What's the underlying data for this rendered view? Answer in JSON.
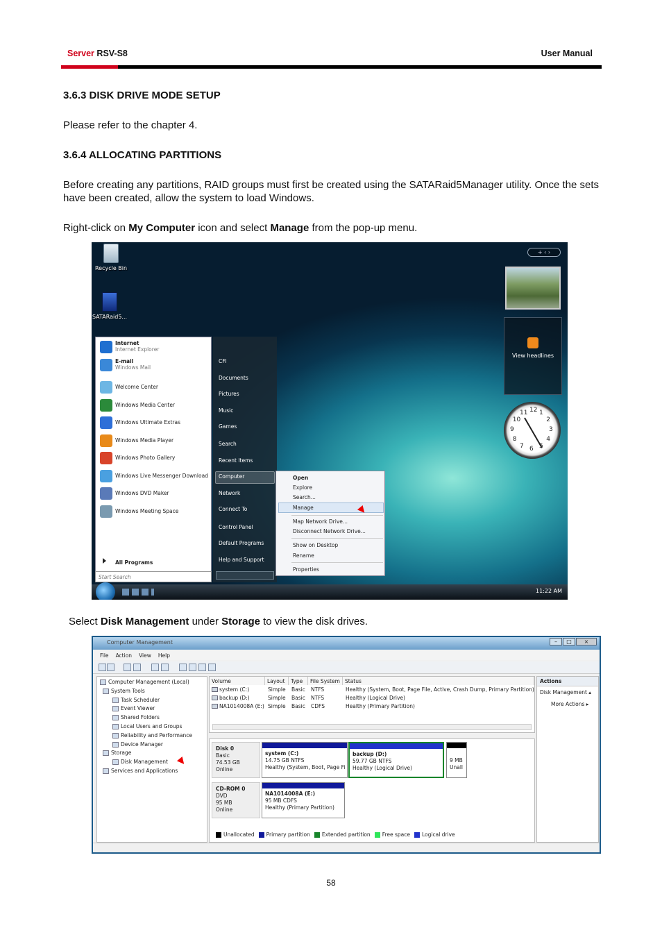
{
  "header": {
    "brand": "Server",
    "model": "RSV-S8",
    "right": "User Manual"
  },
  "sections": [
    {
      "title": "3.6.3 DISK DRIVE MODE SETUP",
      "text": "Please refer to the chapter 4."
    },
    {
      "title": "3.6.4 ALLOCATING PARTITIONS",
      "text": "Before creating any partitions, RAID groups must first be created using the SATARaid5Manager utility. Once the sets have been created, allow the system to load Windows."
    }
  ],
  "instruction1": {
    "pre": "Right-click on ",
    "b1": "My Computer",
    "mid": " icon and select ",
    "b2": "Manage",
    "post": " from the pop-up menu."
  },
  "instruction2": {
    "pre": "Select ",
    "b1": "Disk Management",
    "mid": " under ",
    "b2": "Storage",
    "post": " to view the disk drives."
  },
  "desktop": {
    "icons": [
      "Recycle Bin",
      "SATARaid5..."
    ],
    "gadget_feed": "View headlines",
    "clock_numbers": [
      "12",
      "1",
      "2",
      "3",
      "4",
      "5",
      "6",
      "7",
      "8",
      "9",
      "10",
      "11"
    ],
    "tray_time": "11:22 AM",
    "start_left": [
      {
        "name": "Internet",
        "sub": "Internet Explorer"
      },
      {
        "name": "E-mail",
        "sub": "Windows Mail"
      },
      {
        "name": "Welcome Center"
      },
      {
        "name": "Windows Media Center"
      },
      {
        "name": "Windows Ultimate Extras"
      },
      {
        "name": "Windows Media Player"
      },
      {
        "name": "Windows Photo Gallery"
      },
      {
        "name": "Windows Live Messenger Download"
      },
      {
        "name": "Windows DVD Maker"
      },
      {
        "name": "Windows Meeting Space"
      }
    ],
    "all_programs": "All Programs",
    "start_search": "Start Search",
    "start_right": [
      "CFI",
      "Documents",
      "Pictures",
      "Music",
      "Games",
      "Search",
      "Recent Items",
      "Computer",
      "Network",
      "Connect To",
      "Control Panel",
      "Default Programs",
      "Help and Support"
    ],
    "context_menu": [
      "Open",
      "Explore",
      "Search...",
      "Manage",
      "Map Network Drive...",
      "Disconnect Network Drive...",
      "Show on Desktop",
      "Rename",
      "Properties"
    ]
  },
  "cm": {
    "title": "Computer Management",
    "menu": [
      "File",
      "Action",
      "View",
      "Help"
    ],
    "tree": [
      "Computer Management (Local)",
      "System Tools",
      "Task Scheduler",
      "Event Viewer",
      "Shared Folders",
      "Local Users and Groups",
      "Reliability and Performance",
      "Device Manager",
      "Storage",
      "Disk Management",
      "Services and Applications"
    ],
    "columns": [
      "Volume",
      "Layout",
      "Type",
      "File System",
      "Status"
    ],
    "volumes": [
      [
        "system (C:)",
        "Simple",
        "Basic",
        "NTFS",
        "Healthy (System, Boot, Page File, Active, Crash Dump, Primary Partition)"
      ],
      [
        "backup (D:)",
        "Simple",
        "Basic",
        "NTFS",
        "Healthy (Logical Drive)"
      ],
      [
        "NA1014008A (E:)",
        "Simple",
        "Basic",
        "CDFS",
        "Healthy (Primary Partition)"
      ]
    ],
    "disk0": {
      "name": "Disk 0",
      "type": "Basic",
      "size": "74.53 GB",
      "state": "Online"
    },
    "part_c": {
      "name": "system  (C:)",
      "size": "14.75 GB NTFS",
      "status": "Healthy (System, Boot, Page Fi"
    },
    "part_d": {
      "name": "backup  (D:)",
      "size": "59.77 GB NTFS",
      "status": "Healthy (Logical Drive)"
    },
    "part_un": {
      "size": "9 MB",
      "status": "Unall"
    },
    "cdrom": {
      "name": "CD-ROM 0",
      "type": "DVD",
      "size": "95 MB",
      "state": "Online"
    },
    "part_e": {
      "name": "NA1014008A  (E:)",
      "size": "95 MB CDFS",
      "status": "Healthy (Primary Partition)"
    },
    "legend": [
      "Unallocated",
      "Primary partition",
      "Extended partition",
      "Free space",
      "Logical drive"
    ],
    "legend_colors": [
      "#000000",
      "#10199a",
      "#17852a",
      "#2fe65a",
      "#2233cc"
    ],
    "actions_title": "Actions",
    "actions": [
      "Disk Management",
      "More Actions"
    ]
  },
  "page_number": "58"
}
